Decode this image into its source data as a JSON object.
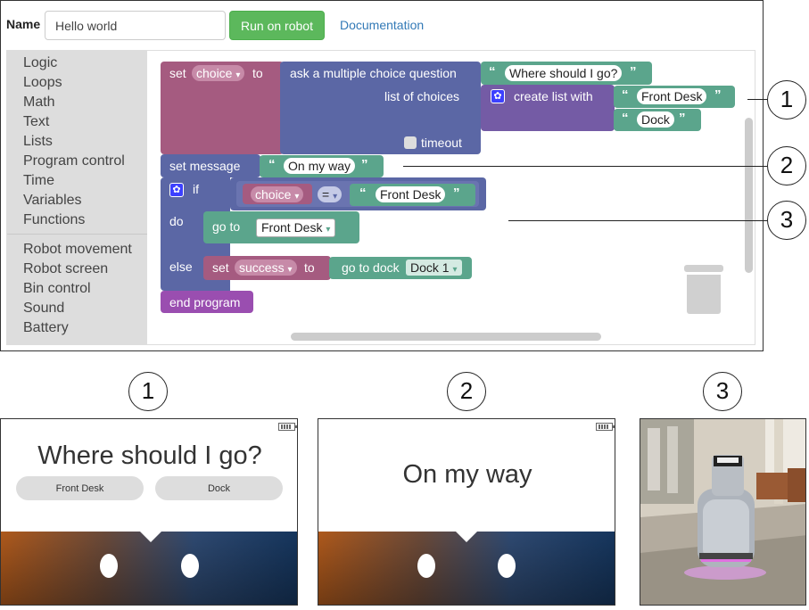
{
  "header": {
    "name_label": "Name",
    "name_value": "Hello world",
    "run_button": "Run on robot",
    "documentation_link": "Documentation"
  },
  "toolbox": {
    "group1": [
      "Logic",
      "Loops",
      "Math",
      "Text",
      "Lists",
      "Program control",
      "Time",
      "Variables",
      "Functions"
    ],
    "group2": [
      "Robot movement",
      "Robot screen",
      "Bin control",
      "Sound",
      "Battery"
    ]
  },
  "blocks": {
    "set": "set",
    "to": "to",
    "var_choice": "choice",
    "ask": "ask a multiple choice question",
    "question": "Where should I go?",
    "list_of_choices": "list of choices",
    "create_list": "create list with",
    "choice1": "Front Desk",
    "choice2": "Dock",
    "timeout": "timeout",
    "set_message": "set message",
    "message": "On my way",
    "if": "if",
    "eq": "=",
    "compare_value": "Front Desk",
    "do": "do",
    "go_to": "go to",
    "go_to_target": "Front Desk",
    "else": "else",
    "var_success": "success",
    "go_to_dock": "go to dock",
    "dock": "Dock 1",
    "end_program": "end program"
  },
  "callouts": [
    "1",
    "2",
    "3"
  ],
  "panels": {
    "panel1": {
      "question": "Where should I go?",
      "option1": "Front Desk",
      "option2": "Dock"
    },
    "panel2": {
      "message": "On my way"
    }
  },
  "icons": {
    "gear": "gear-icon",
    "trash": "trash-icon",
    "battery": "battery-icon",
    "quote": "quote-icon"
  },
  "colors": {
    "variable": "#a55b80",
    "procedure": "#5b67a5",
    "text": "#5ba58c",
    "list": "#745ba5",
    "run_button": "#5cb85c",
    "link": "#337ab7"
  }
}
